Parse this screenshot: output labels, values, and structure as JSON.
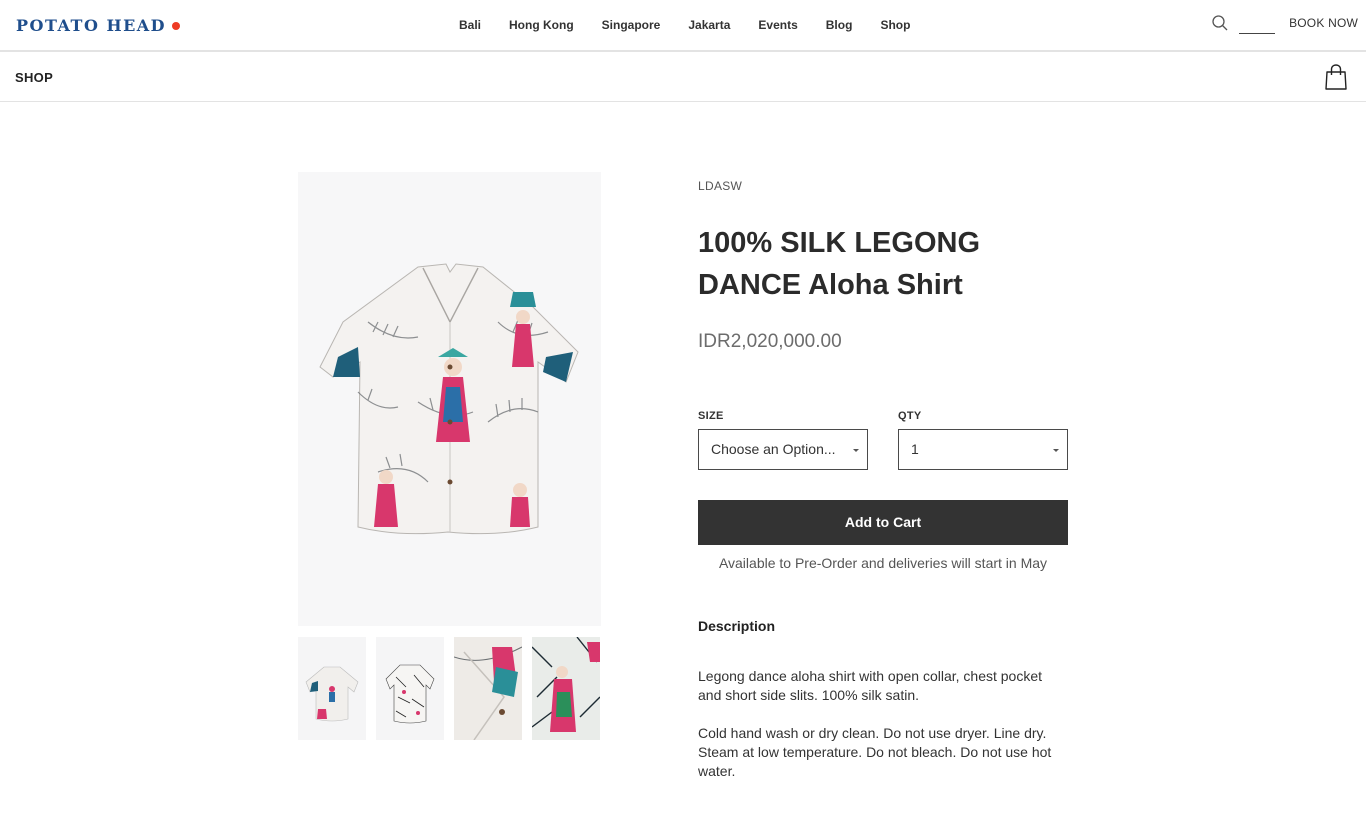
{
  "brand": {
    "name": "POTATO HEAD",
    "dot_color": "#ee3b24",
    "color": "#1f4e8c"
  },
  "nav": {
    "items": [
      "Bali",
      "Hong Kong",
      "Singapore",
      "Jakarta",
      "Events",
      "Blog",
      "Shop"
    ],
    "search_icon": "search-icon",
    "book_now": "BOOK NOW"
  },
  "shopbar": {
    "title": "SHOP",
    "bag_icon": "shopping-bag-icon"
  },
  "product": {
    "vendor": "LDASW",
    "title": "100% SILK LEGONG DANCE Aloha Shirt",
    "price": "IDR2,020,000.00",
    "size_label": "SIZE",
    "size_value": "Choose an Option...",
    "qty_label": "QTY",
    "qty_value": "1",
    "add_to_cart": "Add to Cart",
    "availability": "Available to Pre-Order and deliveries will start in May",
    "description_heading": "Description",
    "description_1": "Legong dance aloha shirt with open collar, chest pocket and short side slits. 100% silk satin.",
    "description_2": "Cold hand wash or dry clean. Do not use dryer. Line dry. Steam at low temperature. Do not bleach. Do not use hot water."
  },
  "colors": {
    "button_bg": "#333333",
    "price": "#6c6c6c"
  }
}
